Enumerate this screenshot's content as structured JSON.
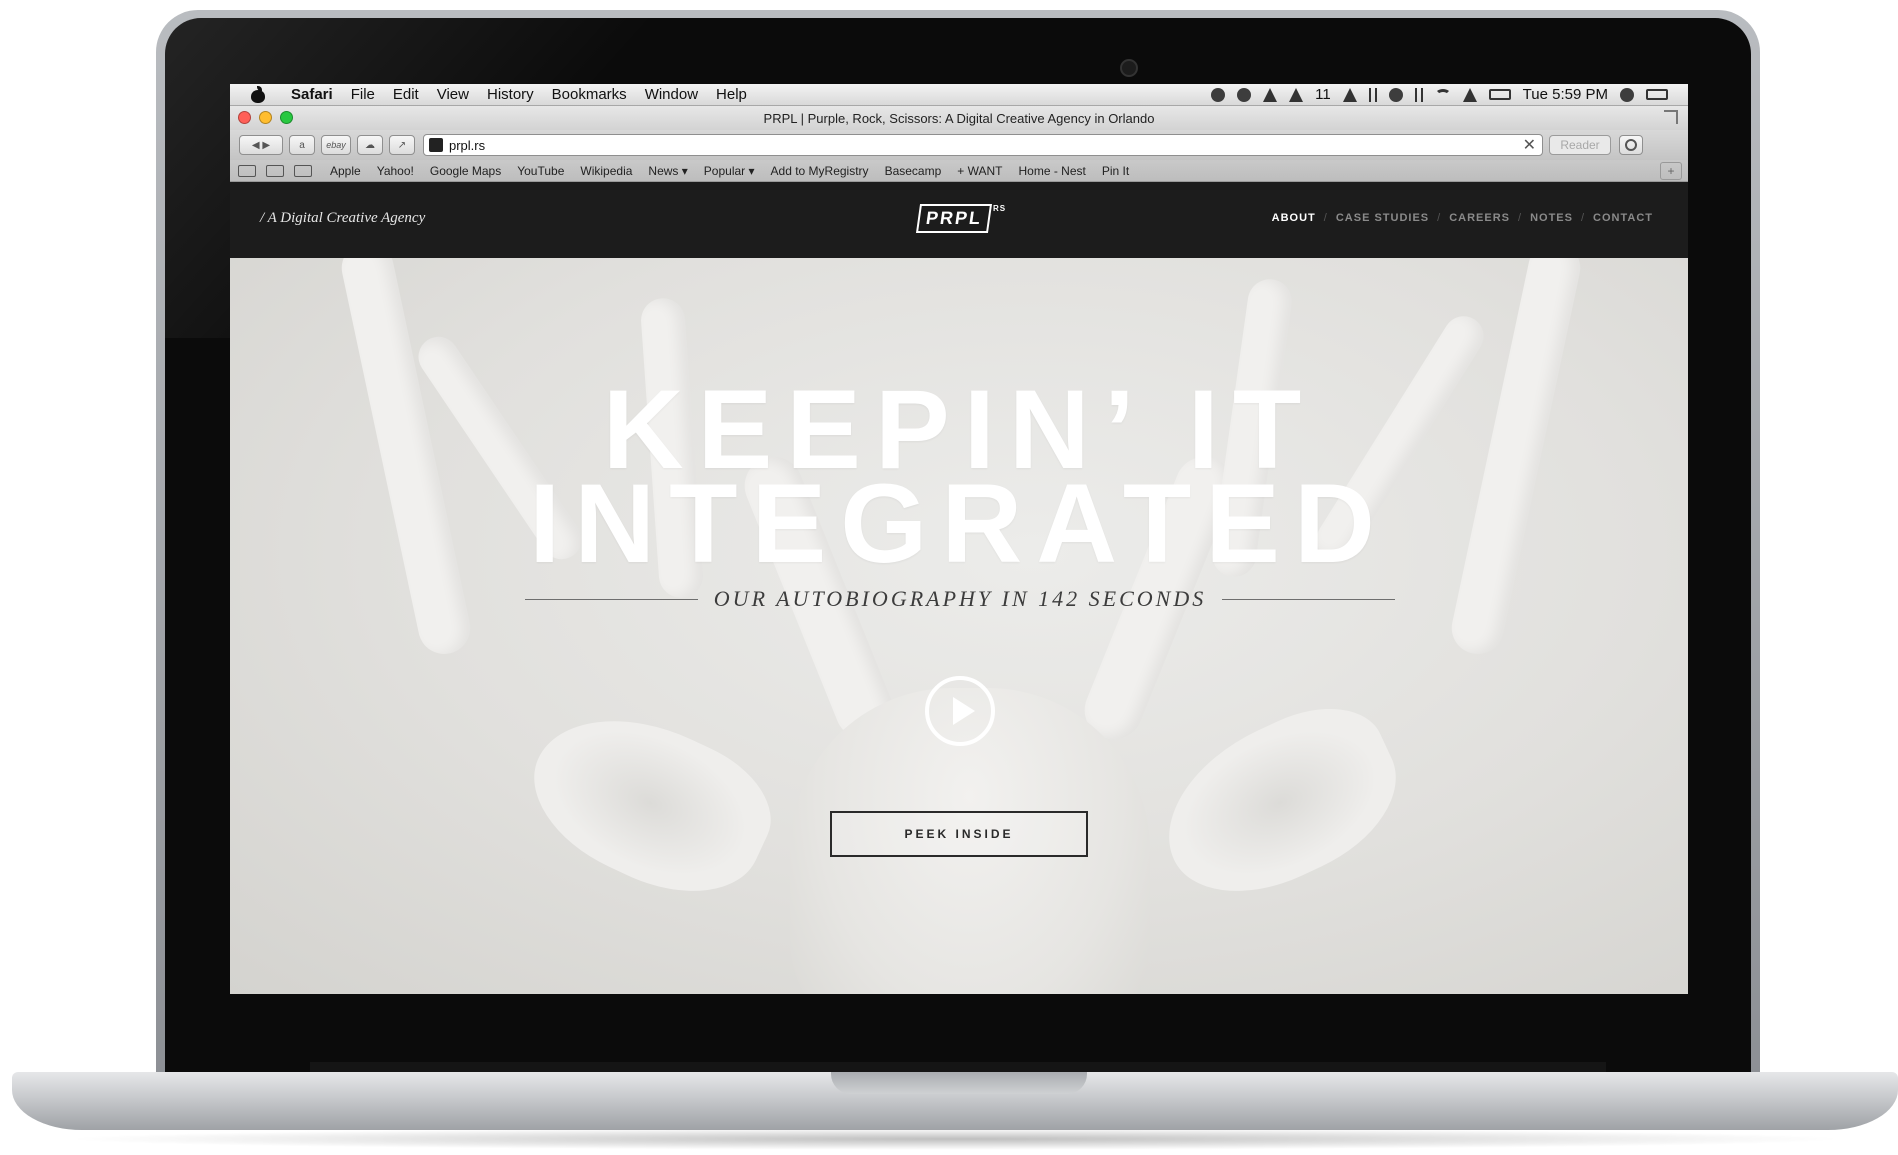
{
  "menubar": {
    "app": "Safari",
    "items": [
      "File",
      "Edit",
      "View",
      "History",
      "Bookmarks",
      "Window",
      "Help"
    ],
    "status": {
      "notification_count": "11",
      "clock": "Tue 5:59 PM"
    }
  },
  "window": {
    "title": "PRPL | Purple, Rock, Scissors: A Digital Creative Agency in Orlando"
  },
  "toolbar": {
    "ebay_label": "ebay",
    "url": "prpl.rs",
    "reader_label": "Reader"
  },
  "bookmarks": [
    "Apple",
    "Yahoo!",
    "Google Maps",
    "YouTube",
    "Wikipedia",
    "News ▾",
    "Popular ▾",
    "Add to MyRegistry",
    "Basecamp",
    "+ WANT",
    "Home - Nest",
    "Pin It"
  ],
  "site": {
    "tagline": "/ A Digital Creative Agency",
    "logo": "PRPL",
    "logo_sup": "RS",
    "nav": [
      "ABOUT",
      "CASE STUDIES",
      "CAREERS",
      "NOTES",
      "CONTACT"
    ],
    "active_nav": "ABOUT"
  },
  "hero": {
    "title_line1": "KEEPIN’ IT",
    "title_line2": "INTEGRATED",
    "subtitle": "OUR AUTOBIOGRAPHY IN 142 SECONDS",
    "cta": "PEEK INSIDE"
  }
}
